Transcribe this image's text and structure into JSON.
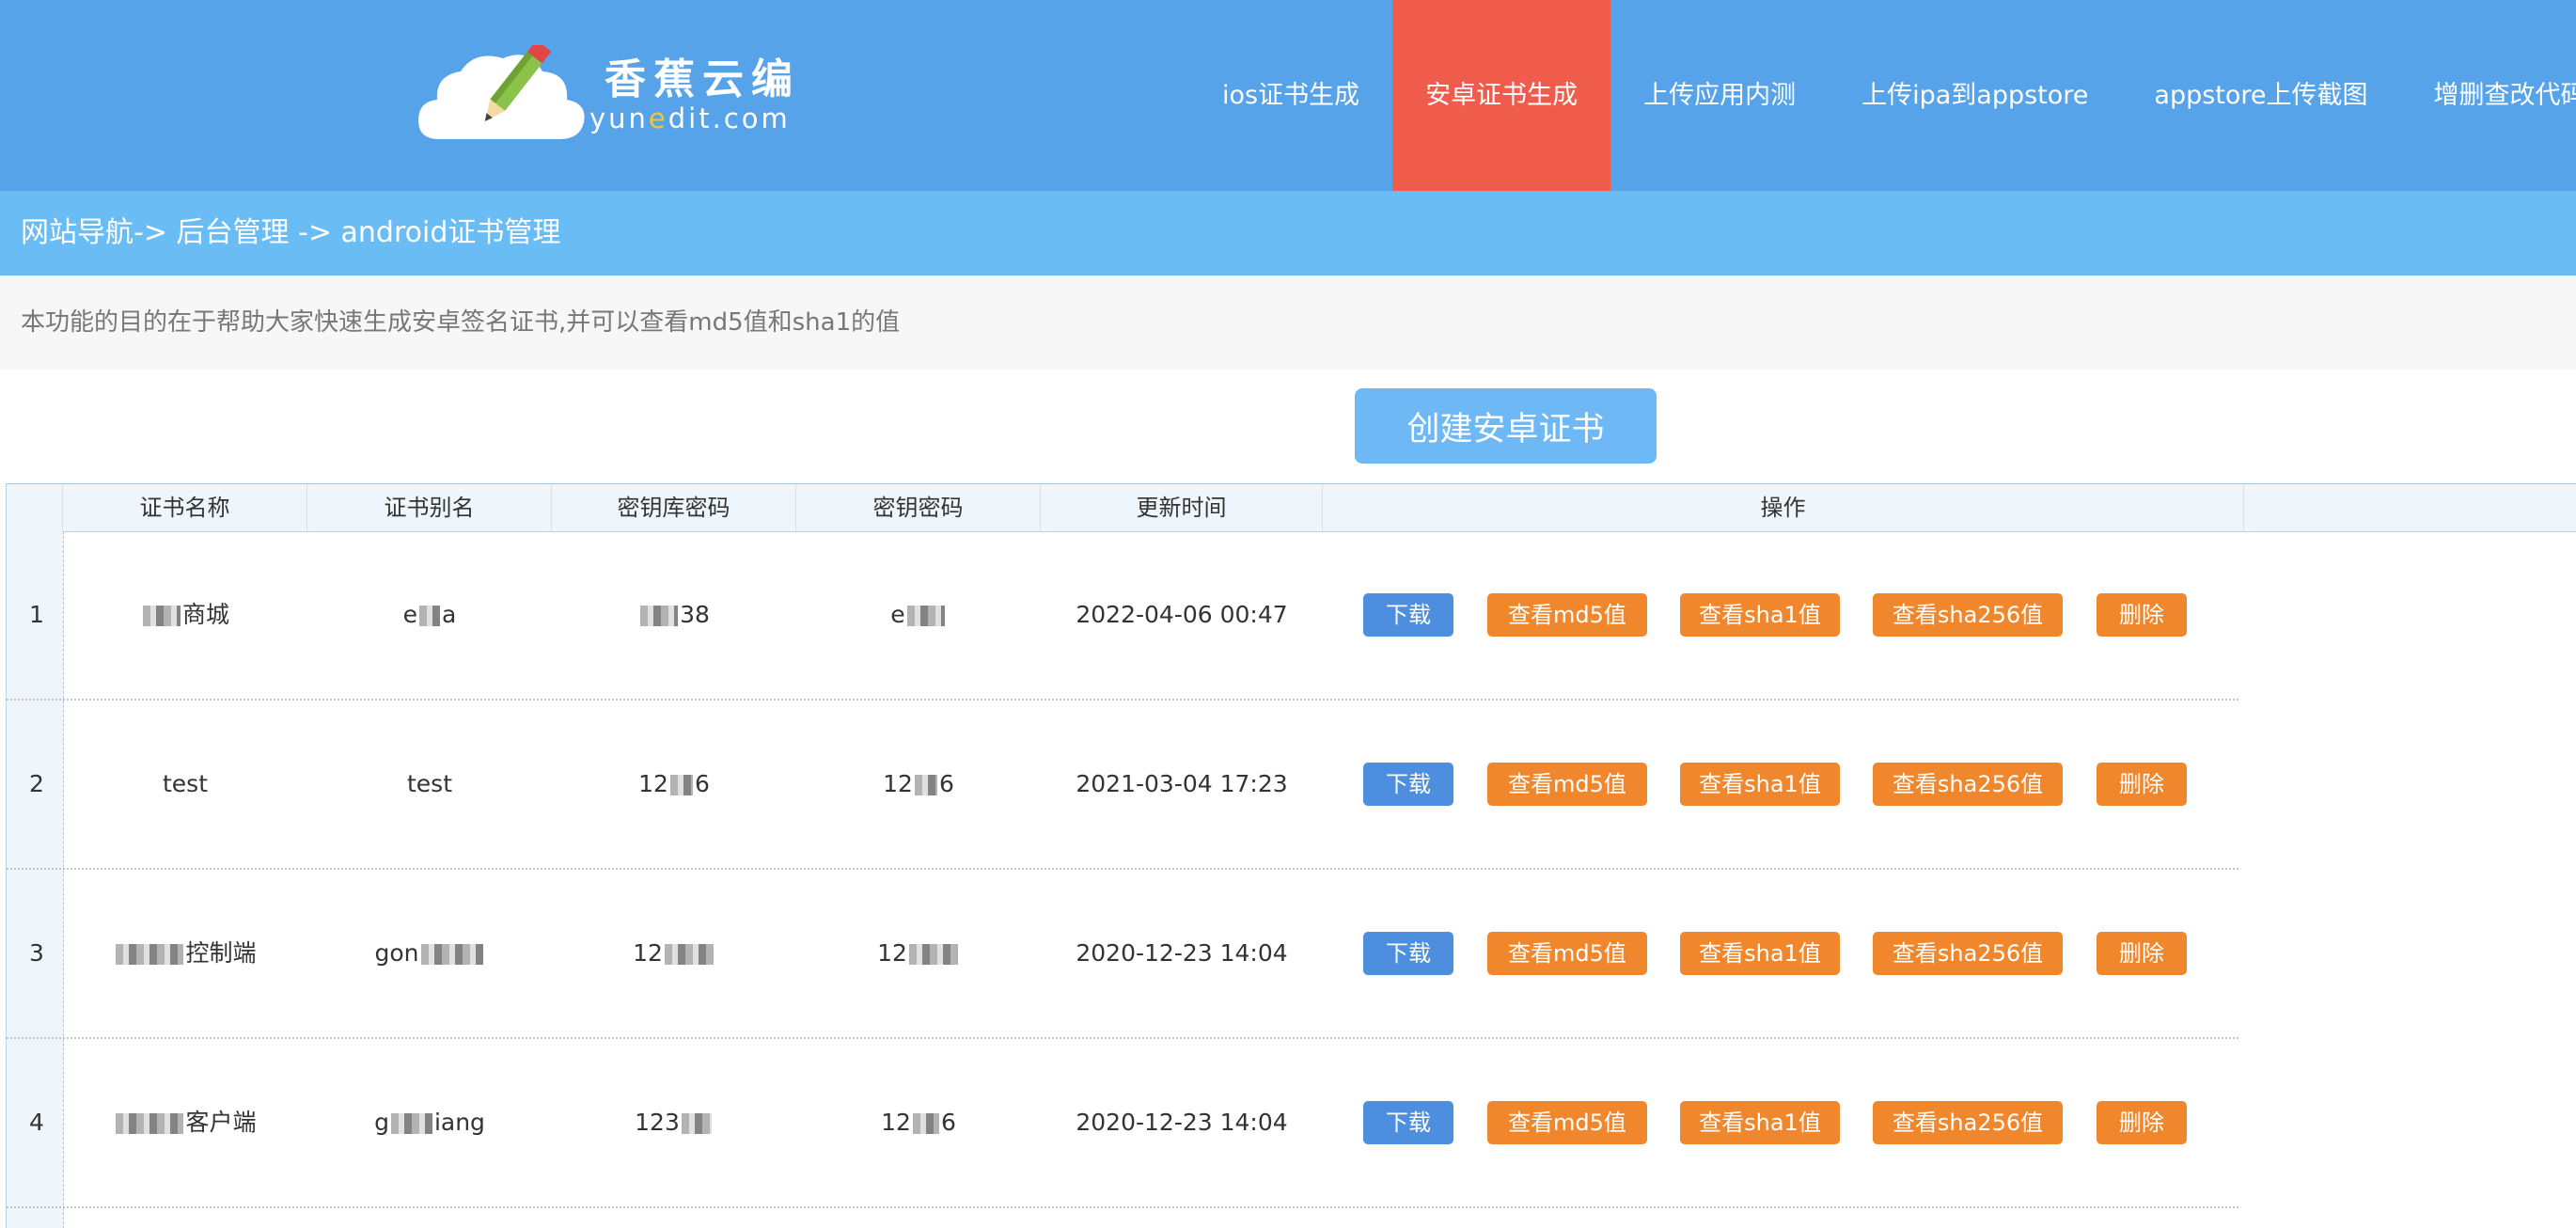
{
  "header": {
    "logo_cn": "香蕉云编",
    "logo_en_a": "yun",
    "logo_en_b": "e",
    "logo_en_c": "dit.com",
    "nav": [
      {
        "label": "ios证书生成",
        "active": false
      },
      {
        "label": "安卓证书生成",
        "active": true
      },
      {
        "label": "上传应用内测",
        "active": false
      },
      {
        "label": "上传ipa到appstore",
        "active": false
      },
      {
        "label": "appstore上传截图",
        "active": false
      },
      {
        "label": "增删查改代码生成",
        "active": false
      }
    ],
    "colors": {
      "bar": "#57a3ea",
      "active": "#ef5c4b"
    }
  },
  "breadcrumb": "网站导航-> 后台管理 -> android证书管理",
  "notice": "本功能的目的在于帮助大家快速生成安卓签名证书,并可以查看md5值和sha1的值",
  "create_button": "创建安卓证书",
  "table": {
    "headers": [
      "证书名称",
      "证书别名",
      "密钥库密码",
      "密钥密码",
      "更新时间",
      "操作"
    ],
    "actions": [
      "下载",
      "查看md5值",
      "查看sha1值",
      "查看sha256值",
      "删除"
    ],
    "rows": [
      {
        "index": "1",
        "name_pre": "",
        "name": "商城",
        "alias_pre": "e",
        "alias": "a",
        "store_pre": "",
        "store": "38",
        "key_pre": "e",
        "key": "",
        "time": "2022-04-06 00:47"
      },
      {
        "index": "2",
        "name_pre": "",
        "name": "test",
        "alias_pre": "",
        "alias": "test",
        "store_pre": "12",
        "store": "6",
        "key_pre": "12",
        "key": "6",
        "time": "2021-03-04 17:23"
      },
      {
        "index": "3",
        "name_pre": "",
        "name": "控制端",
        "alias_pre": "gon",
        "alias": "",
        "store_pre": "12",
        "store": "",
        "key_pre": "12",
        "key": "",
        "time": "2020-12-23 14:04"
      },
      {
        "index": "4",
        "name_pre": "",
        "name": "客户端",
        "alias_pre": "g",
        "alias": "iang",
        "store_pre": "123",
        "store": "",
        "key_pre": "12",
        "key": "6",
        "time": "2020-12-23 14:04"
      }
    ]
  }
}
